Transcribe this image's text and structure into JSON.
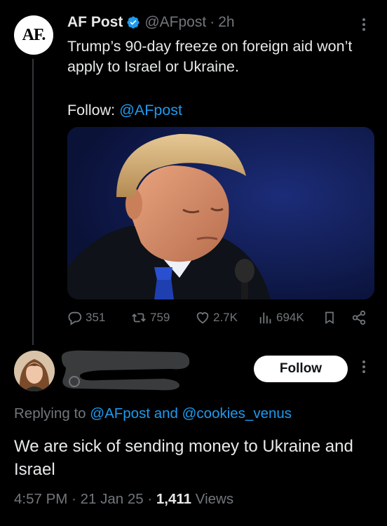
{
  "tweet": {
    "avatar_text": "AF.",
    "author_name": "AF Post",
    "handle": "@AFpost",
    "separator": "·",
    "time": "2h",
    "text": "Trump’s 90-day freeze on foreign aid won’t apply to Israel or Ukraine.",
    "follow_prefix": "Follow:",
    "follow_handle": "@AFpost",
    "stats": {
      "replies": "351",
      "retweets": "759",
      "likes": "2.7K",
      "views": "694K"
    }
  },
  "reply": {
    "follow_label": "Follow",
    "replying_prefix": "Replying to",
    "replying_to": "@AFpost and @cookies_venus",
    "text": "We are sick of sending money to Ukraine and Israel",
    "time": "4:57 PM",
    "date": "21 Jan 25",
    "views_count": "1,411",
    "views_label": "Views"
  },
  "icons": {
    "verified": "verified-badge-icon",
    "more": "more-vertical-icon",
    "reply": "reply-icon",
    "retweet": "retweet-icon",
    "like": "heart-icon",
    "views": "views-bar-chart-icon",
    "bookmark": "bookmark-icon",
    "share": "share-icon"
  },
  "colors": {
    "background": "#000000",
    "text": "#e7e9ea",
    "secondary": "#71767b",
    "link": "#1d9bf0",
    "verified": "#1d9bf0"
  }
}
